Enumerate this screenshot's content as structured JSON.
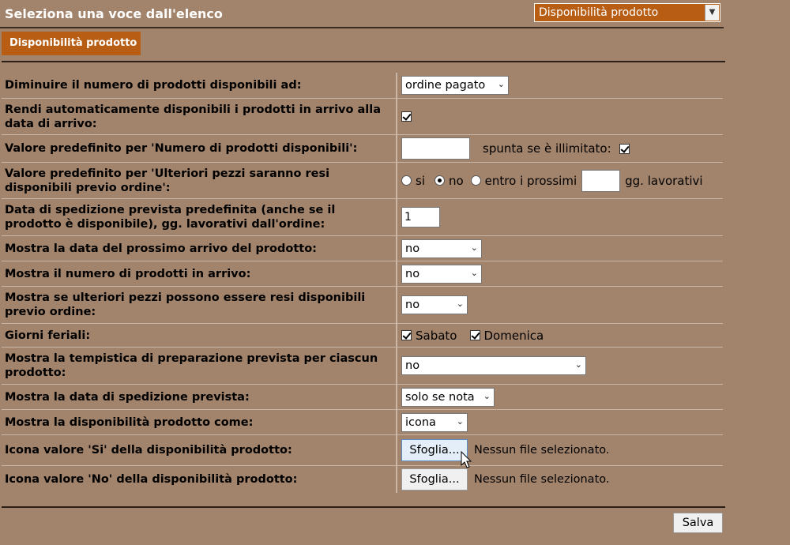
{
  "header": {
    "title": "Seleziona una voce dall'elenco",
    "section_select": "Disponibilità prodotto"
  },
  "tab": {
    "label": "Disponibilità prodotto"
  },
  "rows": [
    {
      "label": "Diminuire il numero di prodotti disponibili ad:",
      "value": "ordine pagato"
    },
    {
      "label": "Rendi automaticamente disponibili i prodotti in arrivo alla data di arrivo:",
      "checked": true
    },
    {
      "label": "Valore predefinito per 'Numero di prodotti disponibili':",
      "value": "",
      "unlimited_label": "spunta se è illimitato:",
      "unlimited_checked": true
    },
    {
      "label": "Valore predefinito per 'Ulteriori pezzi saranno resi disponibili previo ordine':",
      "opt_si": "si",
      "opt_no": "no",
      "opt_entro": "entro i prossimi",
      "days_value": "",
      "days_suffix": "gg. lavorativi",
      "selected": "no"
    },
    {
      "label": "Data di spedizione prevista predefinita (anche se il prodotto è disponibile), gg. lavorativi dall'ordine:",
      "value": "1"
    },
    {
      "label": "Mostra la data del prossimo arrivo del prodotto:",
      "value": "no"
    },
    {
      "label": "Mostra il numero di prodotti in arrivo:",
      "value": "no"
    },
    {
      "label": "Mostra se ulteriori pezzi possono essere resi disponibili previo ordine:",
      "value": "no"
    },
    {
      "label": "Giorni feriali:",
      "sabato": "Sabato",
      "domenica": "Domenica",
      "sabato_checked": true,
      "domenica_checked": true
    },
    {
      "label": "Mostra la tempistica di preparazione prevista per ciascun prodotto:",
      "value": "no"
    },
    {
      "label": "Mostra la data di spedizione prevista:",
      "value": "solo se nota"
    },
    {
      "label": "Mostra la disponibilità prodotto come:",
      "value": "icona"
    },
    {
      "label": "Icona valore 'Si' della disponibilità prodotto:",
      "button": "Sfoglia...",
      "file_status": "Nessun file selezionato."
    },
    {
      "label": "Icona valore 'No' della disponibilità prodotto:",
      "button": "Sfoglia...",
      "file_status": "Nessun file selezionato."
    }
  ],
  "footer": {
    "save_label": "Salva"
  }
}
